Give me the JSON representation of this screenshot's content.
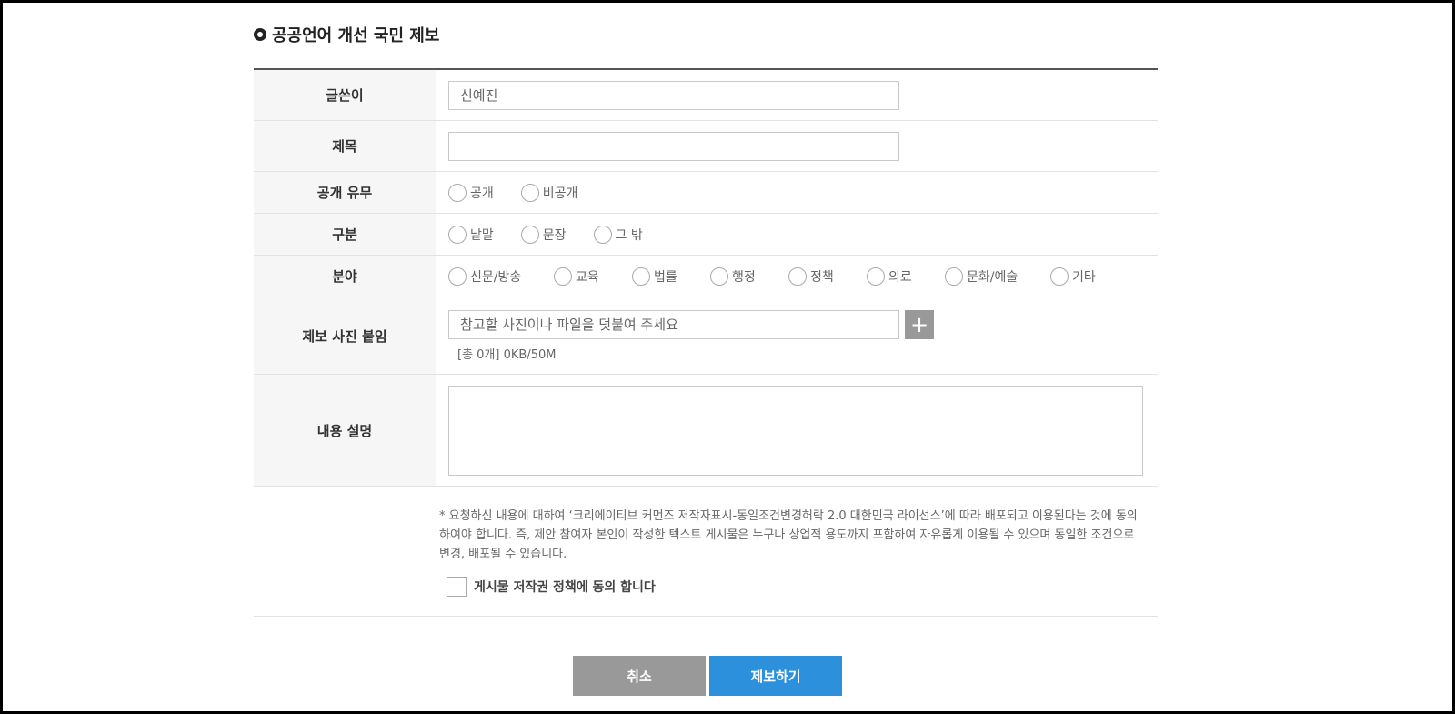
{
  "page": {
    "title": "공공언어 개선 국민 제보"
  },
  "form": {
    "writer": {
      "label": "글쓴이",
      "value": "신예진"
    },
    "subject": {
      "label": "제목",
      "value": ""
    },
    "visibility": {
      "label": "공개 유무",
      "options": [
        "공개",
        "비공개"
      ]
    },
    "category": {
      "label": "구분",
      "options": [
        "낱말",
        "문장",
        "그 밖"
      ]
    },
    "field": {
      "label": "분야",
      "options": [
        "신문/방송",
        "교육",
        "법률",
        "행정",
        "정책",
        "의료",
        "문화/예술",
        "기타"
      ]
    },
    "attachment": {
      "label": "제보 사진 붙임",
      "placeholder": "참고할 사진이나 파일을 덧붙여 주세요",
      "add_icon": "+",
      "info": "[총 0개] 0KB/50M"
    },
    "content": {
      "label": "내용 설명",
      "value": ""
    },
    "agreement": {
      "notice": "* 요청하신 내용에 대하여 ‘크리에이티브 커먼즈 저작자표시-동일조건변경허락 2.0 대한민국 라이선스’에 따라 배포되고 이용된다는 것에 동의하여야 합니다. 즉, 제안 참여자 본인이 작성한 텍스트 게시물은 누구나 상업적 용도까지 포함하여 자유롭게 이용될 수 있으며 동일한 조건으로 변경, 배포될 수 있습니다.",
      "checkbox_label": "게시물 저작권 정책에 동의 합니다"
    }
  },
  "buttons": {
    "cancel": "취소",
    "submit": "제보하기"
  },
  "colors": {
    "submit_button": "#2d90dc",
    "cancel_button": "#999999",
    "label_background": "#f6f6f6"
  }
}
